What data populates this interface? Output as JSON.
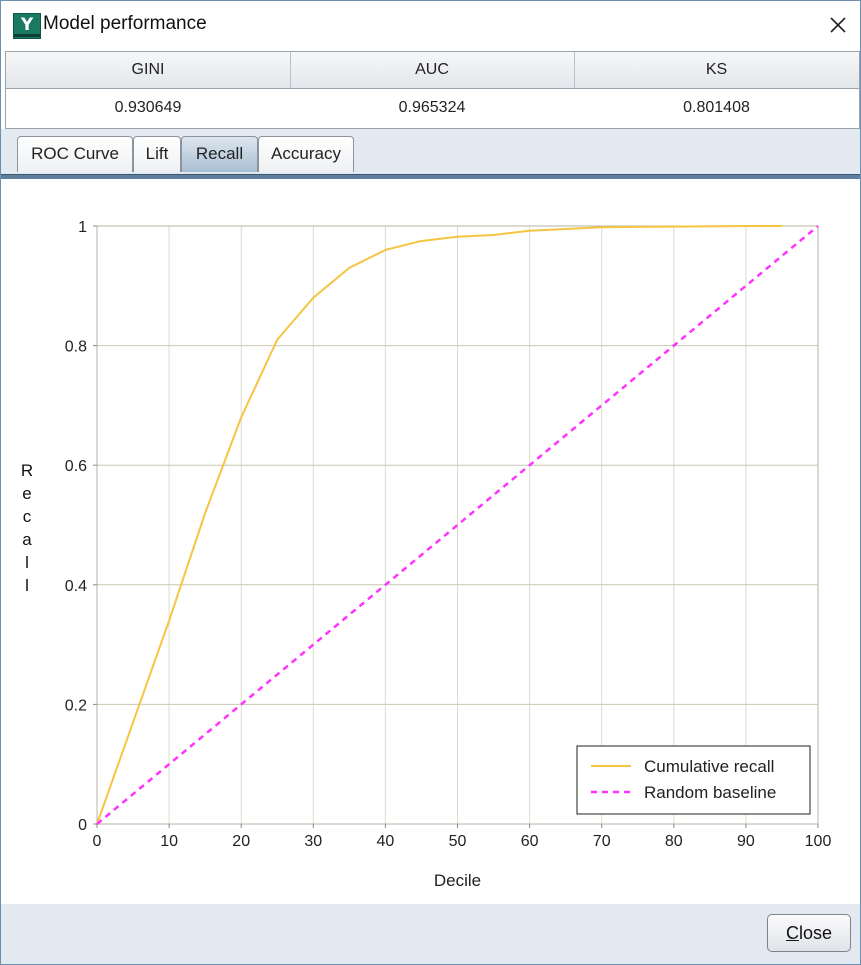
{
  "window": {
    "title": "Model performance",
    "logo_letter": "Y"
  },
  "metrics": {
    "headers": [
      "GINI",
      "AUC",
      "KS"
    ],
    "values": [
      "0.930649",
      "0.965324",
      "0.801408"
    ]
  },
  "tabs": [
    {
      "label": "ROC Curve",
      "active": false
    },
    {
      "label": "Lift",
      "active": false
    },
    {
      "label": "Recall",
      "active": true
    },
    {
      "label": "Accuracy",
      "active": false
    }
  ],
  "chart_data": {
    "type": "line",
    "xlabel": "Decile",
    "ylabel": "Recall",
    "xlim": [
      0,
      100
    ],
    "ylim": [
      0,
      1
    ],
    "xticks": [
      0,
      10,
      20,
      30,
      40,
      50,
      60,
      70,
      80,
      90,
      100
    ],
    "yticks": [
      0,
      0.2,
      0.4,
      0.6,
      0.8,
      1
    ],
    "grid": true,
    "legend_position": "bottom-right",
    "series": [
      {
        "name": "Cumulative recall",
        "color": "#f5c542",
        "dash": "solid",
        "x": [
          0,
          5,
          10,
          15,
          20,
          25,
          30,
          35,
          40,
          45,
          50,
          55,
          60,
          65,
          70,
          80,
          90,
          95
        ],
        "y": [
          0,
          0.17,
          0.34,
          0.52,
          0.68,
          0.81,
          0.88,
          0.93,
          0.96,
          0.975,
          0.982,
          0.985,
          0.992,
          0.995,
          0.998,
          0.999,
          1.0,
          1.0
        ]
      },
      {
        "name": "Random baseline",
        "color": "#ff33ff",
        "dash": "dashed",
        "x": [
          0,
          100
        ],
        "y": [
          0,
          1
        ]
      }
    ]
  },
  "buttons": {
    "close_label_first": "C",
    "close_label_rest": "lose"
  },
  "colors": {
    "accent": "#5f7f9e",
    "grid": "#c8c8b4"
  }
}
